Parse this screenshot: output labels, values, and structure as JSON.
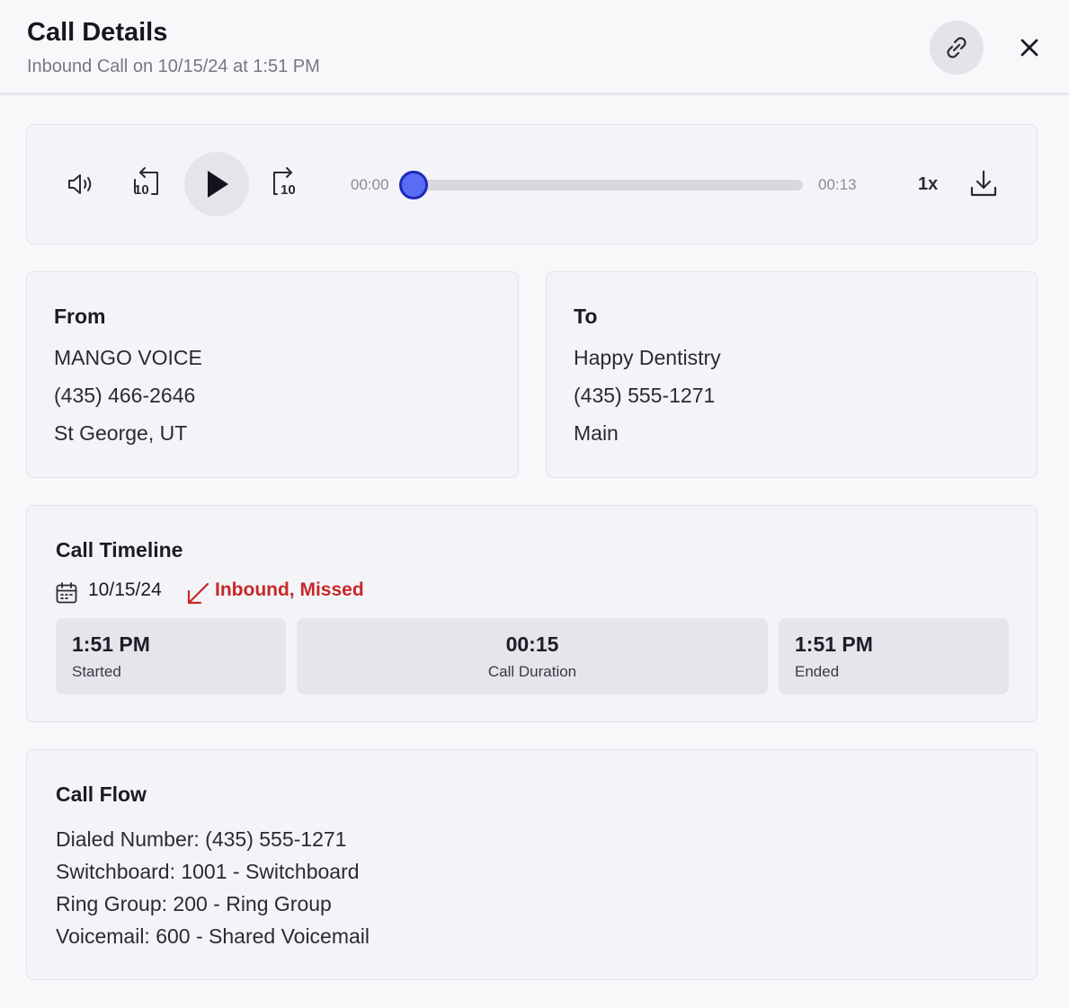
{
  "header": {
    "title": "Call Details",
    "subtitle": "Inbound Call on 10/15/24 at 1:51 PM"
  },
  "player": {
    "rewind_seconds": "10",
    "forward_seconds": "10",
    "current_time": "00:00",
    "total_time": "00:13",
    "speed": "1x",
    "progress": 0,
    "accent_color": "#5b6cf4"
  },
  "from": {
    "title": "From",
    "name": "MANGO VOICE",
    "phone": "(435) 466-2646",
    "location": "St George, UT"
  },
  "to": {
    "title": "To",
    "name": "Happy Dentistry",
    "phone": "(435) 555-1271",
    "line": "Main"
  },
  "timeline": {
    "title": "Call Timeline",
    "date": "10/15/24",
    "status": "Inbound, Missed",
    "status_color": "#c62828",
    "started_value": "1:51 PM",
    "started_label": "Started",
    "duration_value": "00:15",
    "duration_label": "Call Duration",
    "ended_value": "1:51 PM",
    "ended_label": "Ended"
  },
  "flow": {
    "title": "Call Flow",
    "lines": [
      "Dialed Number: (435) 555-1271",
      "Switchboard: 1001 - Switchboard",
      "Ring Group: 200 - Ring Group",
      "Voicemail: 600 - Shared Voicemail"
    ]
  },
  "icons": {
    "link": "link-icon",
    "close": "close-icon",
    "volume": "volume-icon",
    "rewind": "rewind-10-icon",
    "play": "play-icon",
    "forward": "forward-10-icon",
    "download": "download-icon",
    "calendar": "calendar-icon",
    "missed": "missed-call-arrow-icon"
  }
}
